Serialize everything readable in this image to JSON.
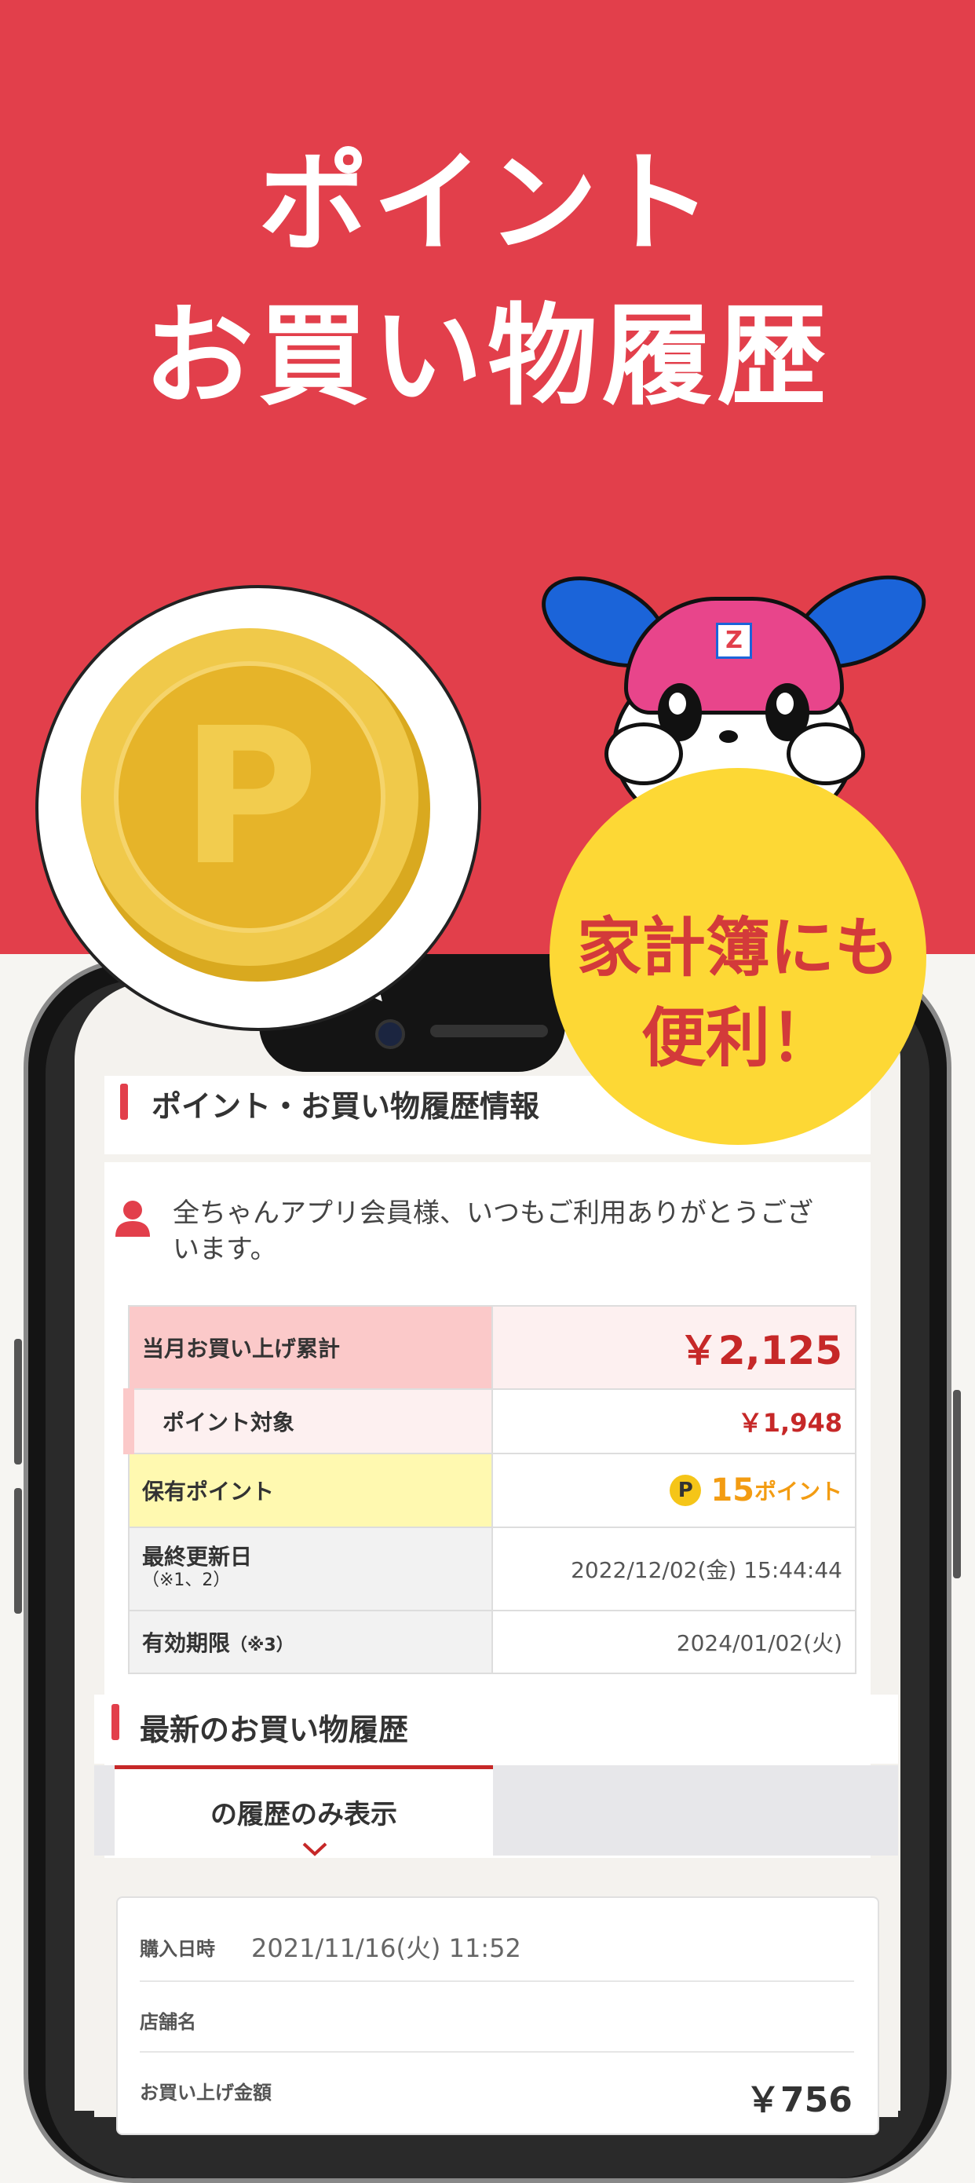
{
  "hero": {
    "title_line1": "ポイント",
    "title_line2": "お買い物履歴"
  },
  "callout": {
    "line1": "家計簿にも",
    "line2": "便利！"
  },
  "coin": {
    "symbol": "P"
  },
  "mascot": {
    "badge": "Z"
  },
  "section1": {
    "title": "ポイント・お買い物履歴情報",
    "greeting_line1": "全ちゃんアプリ会員様、いつもご利用ありがとうござ",
    "greeting_line2": "います。"
  },
  "summary_table": {
    "rows": [
      {
        "label": "当月お買い上げ累計",
        "value": "￥2,125"
      },
      {
        "label": "ポイント対象",
        "value": "￥1,948"
      },
      {
        "label": "保有ポイント",
        "value": "15",
        "unit": "ポイント",
        "icon": "P"
      },
      {
        "label": "最終更新日",
        "note": "（※1、2）",
        "value": "2022/12/02(金) 15:44:44"
      },
      {
        "label": "有効期限",
        "note": "（※3）",
        "value": "2024/01/02(火)"
      }
    ]
  },
  "section2": {
    "title": "最新のお買い物履歴",
    "tab_label": "の履歴のみ表示"
  },
  "history": {
    "purchase_date_label": "購入日時",
    "purchase_date_value": "2021/11/16(火) 11:52",
    "store_label": "店舗名",
    "amount_label": "お買い上げ金額",
    "amount_value": "￥756"
  },
  "colors": {
    "brand_red": "#e23f4b",
    "callout_yellow": "#fdd835",
    "point_orange": "#f39c12",
    "price_red": "#c62828"
  }
}
